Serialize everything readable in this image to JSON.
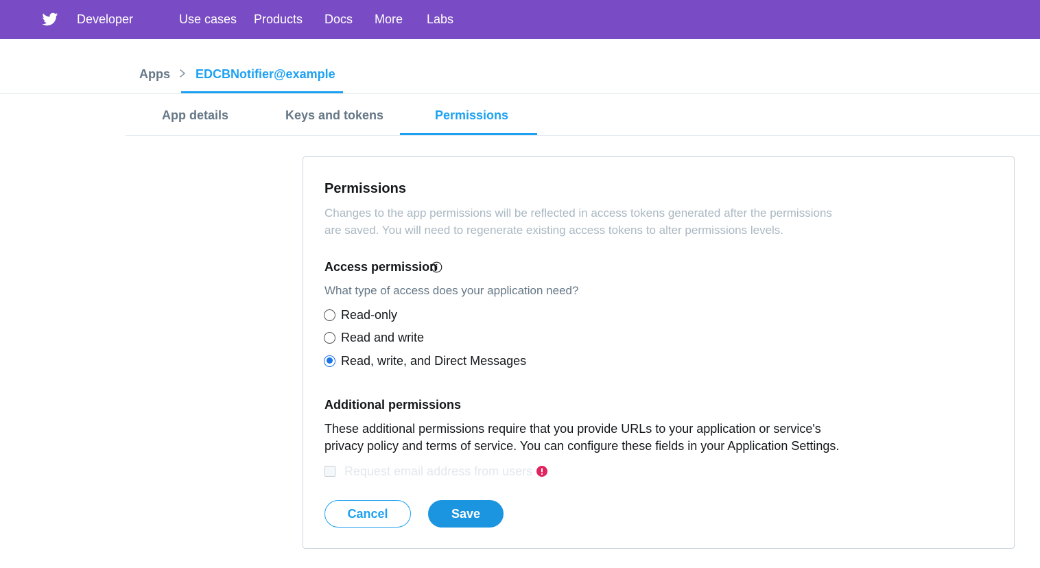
{
  "topbar": {
    "logo_icon": "twitter-bird-icon",
    "brand": "Developer",
    "nav": [
      "Use cases",
      "Products",
      "Docs",
      "More",
      "Labs"
    ],
    "color": "#794bc4"
  },
  "breadcrumb": {
    "root": "Apps",
    "separator_icon": "chevron-right-icon",
    "current": "EDCBNotifier@example"
  },
  "tabs": [
    {
      "label": "App details",
      "active": false
    },
    {
      "label": "Keys and tokens",
      "active": false
    },
    {
      "label": "Permissions",
      "active": true
    }
  ],
  "permissions": {
    "title": "Permissions",
    "description": "Changes to the app permissions will be reflected in access tokens generated after the permissions are saved. You will need to regenerate existing access tokens to alter permissions levels.",
    "access": {
      "heading": "Access permission",
      "info_icon": "info-circle-icon",
      "question": "What type of access does your application need?",
      "options": [
        {
          "label": "Read-only",
          "checked": false
        },
        {
          "label": "Read and write",
          "checked": false
        },
        {
          "label": "Read, write, and Direct Messages",
          "checked": true
        }
      ]
    },
    "additional": {
      "heading": "Additional permissions",
      "text": "These additional permissions require that you provide URLs to your application or service's privacy policy and terms of service. You can configure these fields in your Application Settings.",
      "email_checkbox": {
        "label": "Request email address from users",
        "checked": false,
        "disabled": true
      },
      "alert_icon": "alert-circle-icon"
    },
    "buttons": {
      "cancel": "Cancel",
      "save": "Save"
    }
  },
  "colors": {
    "accent": "#1da1f2",
    "radio_checked": "#1a73e8",
    "alert": "#e0245e"
  }
}
